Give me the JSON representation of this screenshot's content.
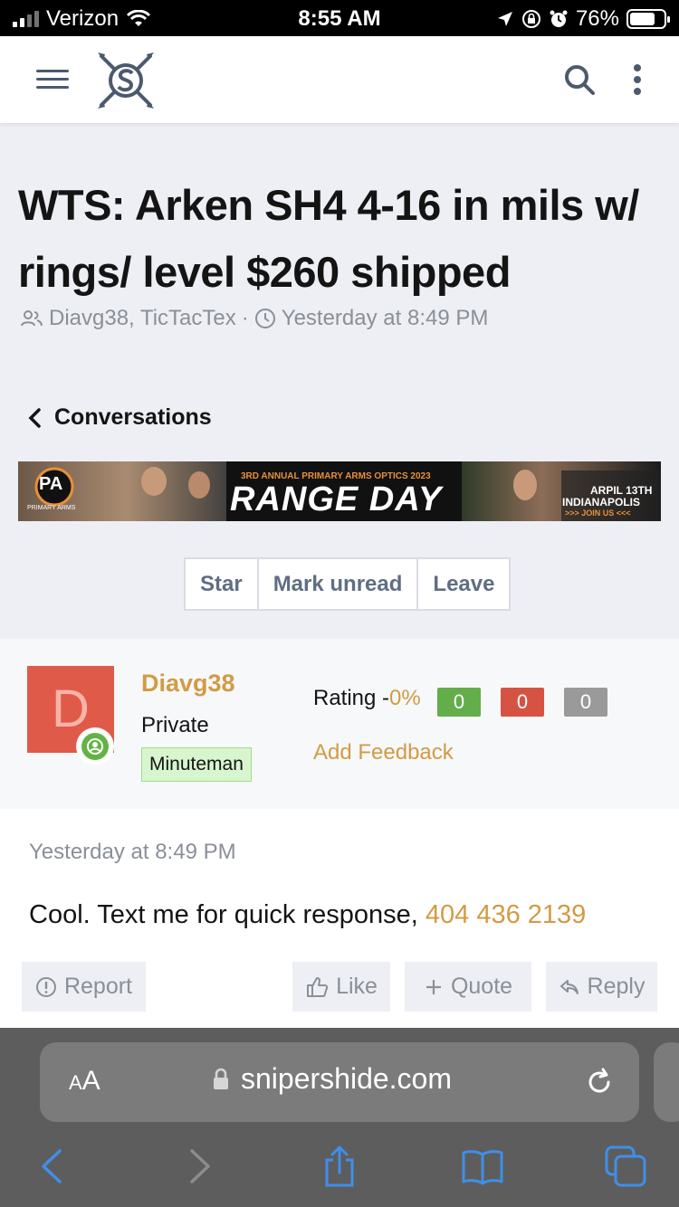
{
  "status_bar": {
    "carrier": "Verizon",
    "time": "8:55 AM",
    "battery": "76%",
    "battery_level": 0.76
  },
  "header": {
    "menu_icon": "hamburger-icon",
    "logo_icon": "snipershide-logo",
    "search_icon": "search-icon",
    "more_icon": "more-vertical-icon"
  },
  "thread": {
    "title": "WTS: Arken SH4 4-16 in mils w/ rings/ level $260 shipped",
    "participants": "Diavg38, TicTacTex",
    "separator": "·",
    "date": "Yesterday at 8:49 PM"
  },
  "back_link": {
    "label": "Conversations"
  },
  "banner": {
    "logo": "PA",
    "brand": "PRIMARY ARMS",
    "subtitle": "3RD ANNUAL PRIMARY ARMS OPTICS 2023",
    "headline": "RANGE DAY",
    "date": "ARPIL 13TH",
    "city": "INDIANAPOLIS",
    "cta": ">>> JOIN US <<<"
  },
  "actions": {
    "star": "Star",
    "mark_unread": "Mark unread",
    "leave": "Leave"
  },
  "user": {
    "avatar_letter": "D",
    "name": "Diavg38",
    "title": "Private",
    "banner": "Minuteman",
    "rating_label": "Rating -",
    "rating_pct": "0%",
    "positive": "0",
    "negative": "0",
    "neutral": "0",
    "add_feedback": "Add Feedback",
    "colors": {
      "positive": "#63ad4b",
      "negative": "#d65343",
      "neutral": "#9a9a9a",
      "accent": "#d29b44"
    }
  },
  "post": {
    "time": "Yesterday at 8:49 PM",
    "text": "Cool. Text me for quick response,",
    "phone": "404 436 2139",
    "report": "Report",
    "like": "Like",
    "quote": "Quote",
    "reply": "Reply"
  },
  "browser": {
    "text_size": "AA",
    "domain": "snipershide.com"
  }
}
